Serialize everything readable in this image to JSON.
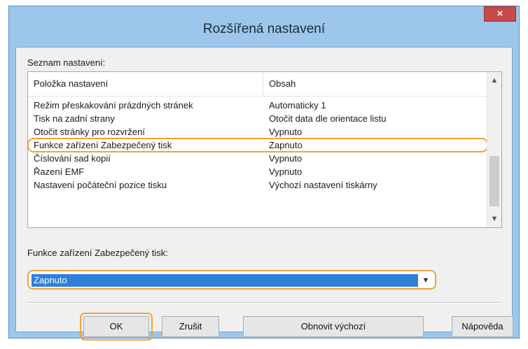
{
  "window": {
    "title": "Rozšířená nastavení",
    "close_glyph": "×"
  },
  "list": {
    "label": "Seznam nastavení:",
    "columns": [
      "Položka nastavení",
      "Obsah"
    ],
    "rows": [
      {
        "item": "Režim přeskakování prázdných stránek",
        "value": "Automaticky 1"
      },
      {
        "item": "Tisk na zadní strany",
        "value": "Otočit data dle orientace listu"
      },
      {
        "item": "Otočit stránky pro rozvržení",
        "value": "Vypnuto"
      },
      {
        "item": "Funkce zařízení Zabezpečený tisk",
        "value": "Zapnuto"
      },
      {
        "item": "Číslování sad kopií",
        "value": "Vypnuto"
      },
      {
        "item": "Řazení EMF",
        "value": "Vypnuto"
      },
      {
        "item": "Nastavení počáteční pozice tisku",
        "value": "Výchozí nastavení tiskárny"
      }
    ],
    "highlighted_row": 3
  },
  "setting": {
    "label": "Funkce zařízení Zabezpečený tisk:",
    "value": "Zapnuto"
  },
  "buttons": {
    "ok": "OK",
    "cancel": "Zrušit",
    "reset": "Obnovit výchozí",
    "help": "Nápověda"
  },
  "colors": {
    "highlight_outline": "#f2a33a",
    "selection": "#2f7fd9",
    "title_bar": "#9cc7eb",
    "close_button": "#c74a4a"
  }
}
